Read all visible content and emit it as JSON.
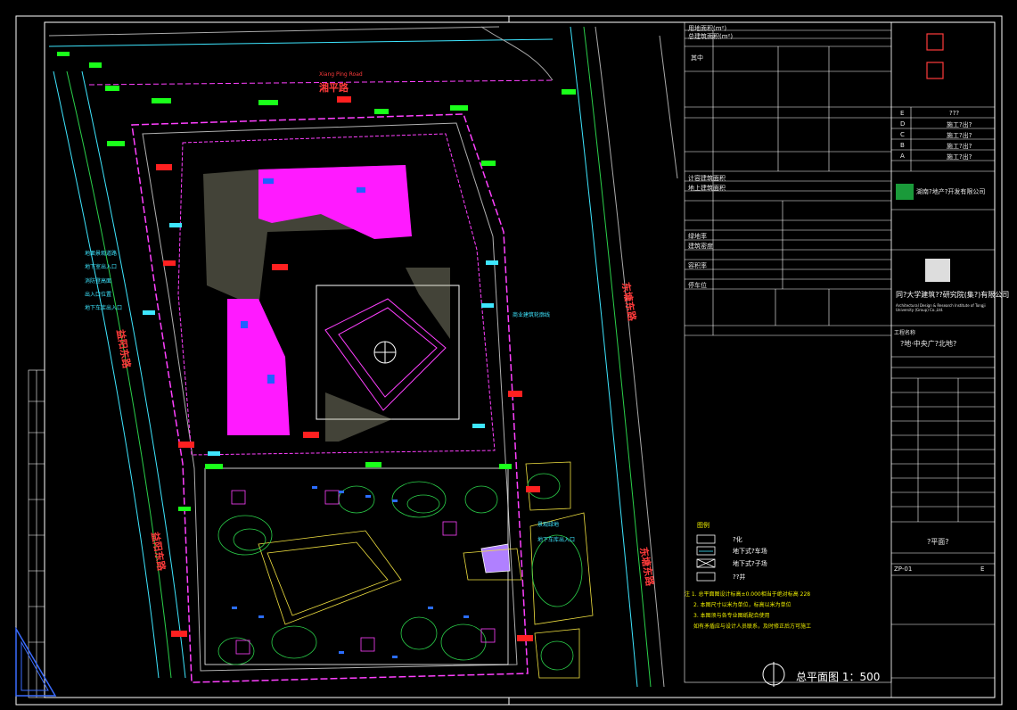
{
  "drawing": {
    "road_north": "Xiang Ping Road",
    "road_north_cn": "湘平路",
    "road_west": "Yi Yang Dong Lu",
    "road_west_cn": "益阳东路",
    "road_east": "Dong Tang Dong Lu",
    "road_east_cn": "东塘东路",
    "road_west2_cn": "益阳东路",
    "scale_title": "总平面图  1：500"
  },
  "legend": {
    "title": "图例",
    "items": [
      "?化",
      "地下式?车场",
      "地下式?子场",
      "??井"
    ]
  },
  "notes": [
    "注 1. 总平面图设计标高±0.000相当于绝对标高 228",
    "2. 本图尺寸以米为单位，标高以米为单位",
    "3. 本图须与各专业图纸配合使用",
    "如有矛盾应与设计人员联系，及时修正后方可施工"
  ],
  "callouts_left": [
    "地面景观道路",
    "地下室出入口",
    "消防登高面",
    "出入口位置",
    "地下车库出入口"
  ],
  "callouts_right": [
    "商业建筑轮廓线",
    "景观绿地",
    "地下车库出入口"
  ],
  "title_block": {
    "rows": [
      "用地面积(m²)",
      "总建筑面积(m²)",
      "其中",
      "计容建筑面积",
      "地上建筑面积",
      "绿地率",
      "建筑密度",
      "容积率",
      "停车位"
    ],
    "vals": [
      "?",
      "?"
    ],
    "revisions": [
      "E",
      "D",
      "C",
      "B",
      "A"
    ],
    "revision_desc": [
      "???",
      "施工?出?",
      "施工?出?",
      "施工?出?",
      "施工?出?"
    ],
    "client_cn": "湖南?地产?开发有限公司",
    "design_institute_cn": "同?大学建筑??研究院(集?)有限公司",
    "design_institute_en": "Architectural Design & Research Institute of Tongji University (Group) Co.,Ltd.",
    "project_label": "工程名称",
    "project_cn": "?地·中央广?北地?",
    "drawing_title": "?平面?",
    "drawing_no": "ZP-01",
    "phase": "E"
  }
}
